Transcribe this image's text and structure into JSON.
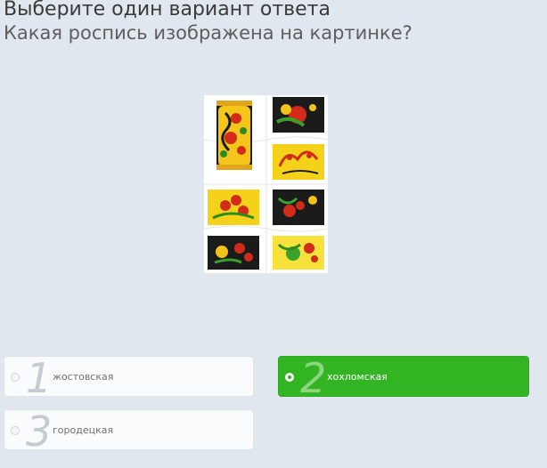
{
  "question": {
    "instruction": "Выберите один вариант ответа",
    "text": "Какая роспись изображена на картинке?",
    "image_icon": "khokhloma-painting-image"
  },
  "options": [
    {
      "number": "1",
      "label": "жостовская",
      "selected": false
    },
    {
      "number": "2",
      "label": "хохломская",
      "selected": true
    },
    {
      "number": "3",
      "label": "городецкая",
      "selected": false
    }
  ],
  "colors": {
    "background": "#e1e7ee",
    "selected": "#33b422",
    "option_bg": "#fafbfc",
    "painting_red": "#d22b1a",
    "painting_gold": "#f2c318",
    "painting_black": "#1b1b1b"
  }
}
